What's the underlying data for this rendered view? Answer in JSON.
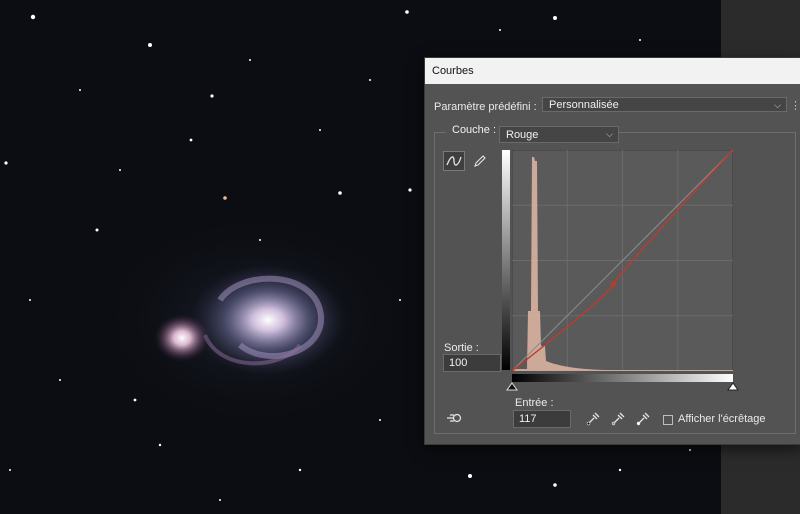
{
  "dialog": {
    "title": "Courbes",
    "preset_label": "Paramètre prédéfini :",
    "preset_value": "Personnalisée",
    "channel_label": "Couche :",
    "channel_value": "Rouge",
    "output_label": "Sortie :",
    "output_value": "100",
    "input_label": "Entrée :",
    "input_value": "117",
    "clipping_label": "Afficher l'écrêtage",
    "clipping_checked": false
  },
  "curve": {
    "range": [
      0,
      255
    ],
    "points": [
      [
        0,
        0
      ],
      [
        117,
        100
      ],
      [
        255,
        255
      ]
    ]
  },
  "colors": {
    "dialog_bg": "#535353",
    "curve": "#c0392b",
    "histogram": "#e2b7a6"
  },
  "icons": {
    "curve_tool": "curve-icon",
    "pencil_tool": "pencil-icon",
    "sample_tool": "hand-adjust-icon",
    "black_dropper": "eyedropper-black-icon",
    "gray_dropper": "eyedropper-gray-icon",
    "white_dropper": "eyedropper-white-icon"
  }
}
